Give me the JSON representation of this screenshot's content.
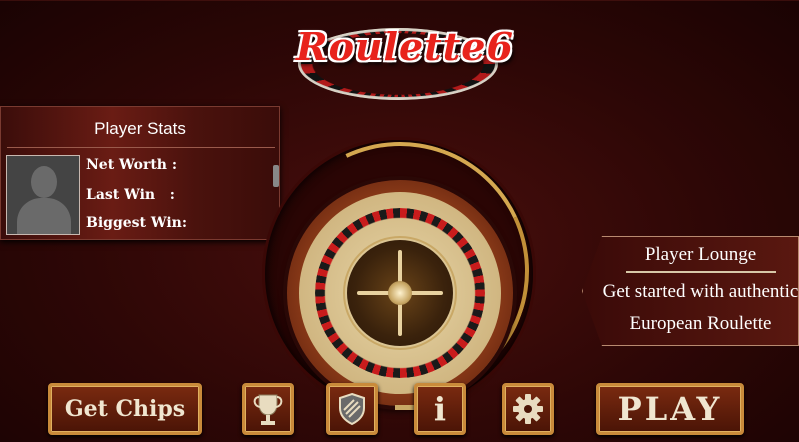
{
  "logo": {
    "text": "Roulette6"
  },
  "player_stats": {
    "title": "Player Stats",
    "net_worth_label": "Net Worth :",
    "last_win_label": "Last Win   :",
    "biggest_win_label": "Biggest Win:"
  },
  "player_lounge": {
    "title": "Player Lounge",
    "line1": "Get started with authentic",
    "line2": "European Roulette"
  },
  "buttons": {
    "get_chips": "Get Chips",
    "play": "PLAY",
    "info": "i"
  },
  "icons": {
    "trophy": "trophy-icon",
    "shield": "shield-icon",
    "info": "info-icon",
    "gear": "gear-icon"
  },
  "colors": {
    "background": "#2e0706",
    "accent_gold": "#c98a3a",
    "logo_red": "#e8231c"
  }
}
